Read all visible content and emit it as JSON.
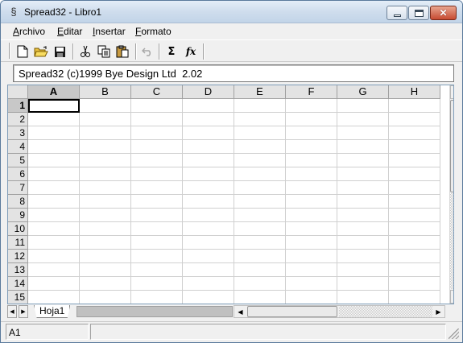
{
  "window": {
    "title": "Spread32 - Libro1",
    "icon": "spread32-app-icon"
  },
  "menu": [
    {
      "label": "Archivo",
      "hotkey": "A",
      "rest": "rchivo"
    },
    {
      "label": "Editar",
      "hotkey": "E",
      "rest": "ditar"
    },
    {
      "label": "Insertar",
      "hotkey": "I",
      "rest": "nsertar"
    },
    {
      "label": "Formato",
      "hotkey": "F",
      "rest": "ormato"
    }
  ],
  "toolbar": {
    "icons": [
      "new-file-icon",
      "open-folder-icon",
      "save-icon",
      "cut-icon",
      "copy-icon",
      "paste-icon",
      "undo-icon",
      "autosum-icon",
      "function-icon"
    ],
    "sum_symbol": "Σ",
    "fx_symbol": "fx"
  },
  "infobox": {
    "text": "Spread32 (c)1999 Bye Design Ltd  2.02"
  },
  "grid": {
    "columns": [
      "A",
      "B",
      "C",
      "D",
      "E",
      "F",
      "G",
      "H"
    ],
    "rows": [
      "1",
      "2",
      "3",
      "4",
      "5",
      "6",
      "7",
      "8",
      "9",
      "10",
      "11",
      "12",
      "13",
      "14",
      "15"
    ],
    "selected_column": "A",
    "selected_row": "1"
  },
  "sheets": {
    "tabs": [
      "Hoja1"
    ],
    "active": "Hoja1"
  },
  "status": {
    "cell_ref": "A1",
    "message": ""
  }
}
